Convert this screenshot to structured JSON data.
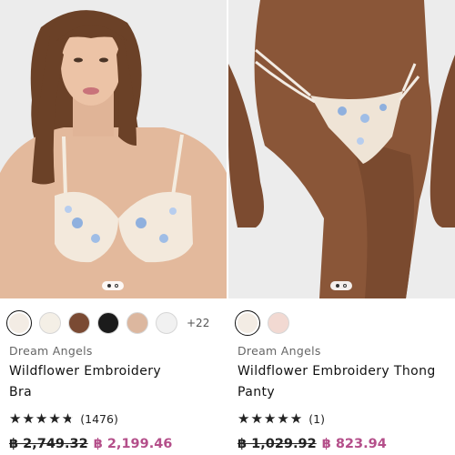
{
  "products": [
    {
      "brand": "Dream Angels",
      "name_line1": "Wildflower Embroidery",
      "name_line2": "Bra",
      "rating_count": "(1476)",
      "rating": 4.7,
      "old_price": "฿ 2,749.32",
      "new_price": "฿ 2,199.46",
      "more_swatches": "+22",
      "swatch_colors": [
        "#f3ece4",
        "#f4efe6",
        "#7a4a33",
        "#1b1b1b",
        "#dcb79f",
        "#f1f1f1"
      ],
      "image_dots": 2
    },
    {
      "brand": "Dream Angels",
      "name_line1": "Wildflower Embroidery Thong",
      "name_line2": "Panty",
      "rating_count": "(1)",
      "rating": 5,
      "old_price": "฿ 1,029.92",
      "new_price": "฿ 823.94",
      "swatch_colors": [
        "#f3ece4",
        "#f2d9d2"
      ],
      "image_dots": 2
    }
  ],
  "stars_glyph": "★★★★★",
  "colors": {
    "sale_price": "#b44f8a"
  }
}
